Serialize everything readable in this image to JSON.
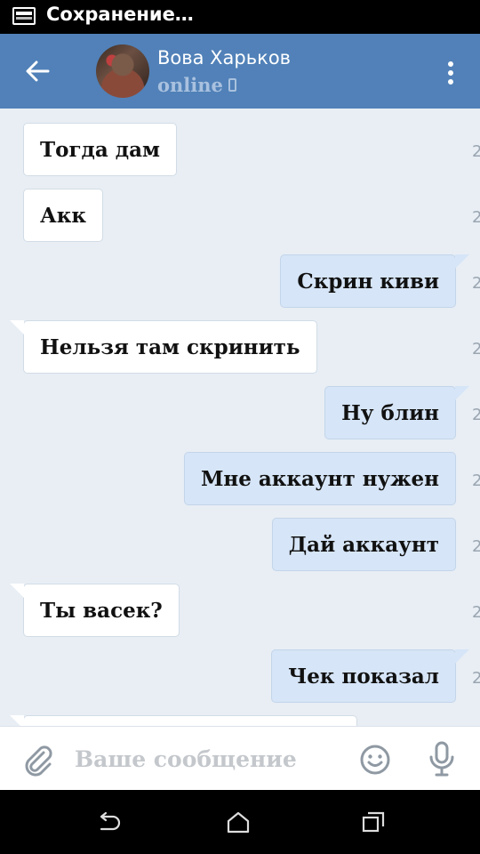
{
  "status_bar": {
    "notification_text": "Сохранение…",
    "icon": "screenshot-save-icon"
  },
  "header": {
    "back_icon": "arrow-left-icon",
    "contact_name": "Вова Харьков",
    "contact_status": "online",
    "status_device_icon": "mobile-phone-icon",
    "menu_icon": "more-vertical-icon",
    "accent_color": "#5181b8"
  },
  "messages": [
    {
      "direction": "in",
      "text": "Тогда дам",
      "time_clip": "2"
    },
    {
      "direction": "in",
      "text": "Акк",
      "time_clip": "2"
    },
    {
      "direction": "out",
      "text": "Скрин киви",
      "time_clip": "2"
    },
    {
      "direction": "in",
      "text": "Нельзя там скринить",
      "time_clip": "2"
    },
    {
      "direction": "out",
      "text": "Ну блин",
      "time_clip": "2"
    },
    {
      "direction": "out",
      "text": "Мне аккаунт нужен",
      "time_clip": "2"
    },
    {
      "direction": "out",
      "text": "Дай аккаунт",
      "time_clip": "2"
    },
    {
      "direction": "in",
      "text": "Ты васек?",
      "time_clip": "2"
    },
    {
      "direction": "out",
      "text": "Чек показал",
      "time_clip": "2"
    }
  ],
  "composer": {
    "placeholder": "Ваше сообщение",
    "attach_icon": "paperclip-icon",
    "emoji_icon": "smiley-icon",
    "mic_icon": "microphone-icon"
  },
  "nav_bar": {
    "back_icon": "nav-back-icon",
    "home_icon": "nav-home-icon",
    "recents_icon": "nav-recents-icon"
  }
}
